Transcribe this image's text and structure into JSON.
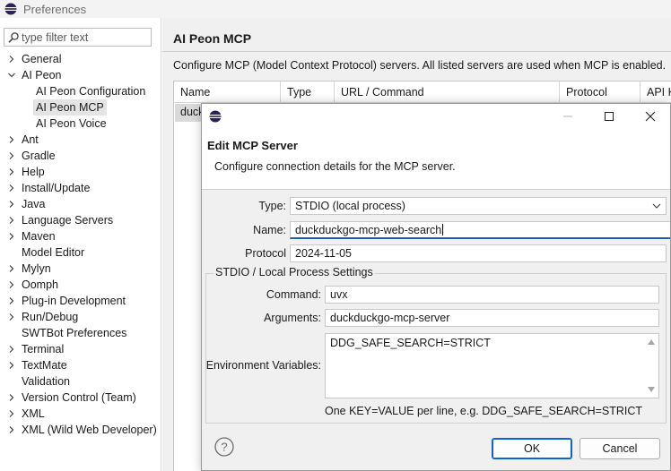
{
  "window": {
    "title": "Preferences"
  },
  "filter": {
    "placeholder": "type filter text"
  },
  "tree": [
    {
      "label": "General",
      "toggle": "collapsed",
      "level": 0
    },
    {
      "label": "AI Peon",
      "toggle": "expanded",
      "level": 0
    },
    {
      "label": "AI Peon Configuration",
      "toggle": "none",
      "level": 1
    },
    {
      "label": "AI Peon MCP",
      "toggle": "none",
      "level": 1,
      "selected": true
    },
    {
      "label": "AI Peon Voice",
      "toggle": "none",
      "level": 1
    },
    {
      "label": "Ant",
      "toggle": "collapsed",
      "level": 0
    },
    {
      "label": "Gradle",
      "toggle": "collapsed",
      "level": 0
    },
    {
      "label": "Help",
      "toggle": "collapsed",
      "level": 0
    },
    {
      "label": "Install/Update",
      "toggle": "collapsed",
      "level": 0
    },
    {
      "label": "Java",
      "toggle": "collapsed",
      "level": 0
    },
    {
      "label": "Language Servers",
      "toggle": "collapsed",
      "level": 0
    },
    {
      "label": "Maven",
      "toggle": "collapsed",
      "level": 0
    },
    {
      "label": "Model Editor",
      "toggle": "none",
      "level": 0
    },
    {
      "label": "Mylyn",
      "toggle": "collapsed",
      "level": 0
    },
    {
      "label": "Oomph",
      "toggle": "collapsed",
      "level": 0
    },
    {
      "label": "Plug-in Development",
      "toggle": "collapsed",
      "level": 0
    },
    {
      "label": "Run/Debug",
      "toggle": "collapsed",
      "level": 0
    },
    {
      "label": "SWTBot Preferences",
      "toggle": "none",
      "level": 0
    },
    {
      "label": "Terminal",
      "toggle": "collapsed",
      "level": 0
    },
    {
      "label": "TextMate",
      "toggle": "collapsed",
      "level": 0
    },
    {
      "label": "Validation",
      "toggle": "none",
      "level": 0
    },
    {
      "label": "Version Control (Team)",
      "toggle": "collapsed",
      "level": 0
    },
    {
      "label": "XML",
      "toggle": "collapsed",
      "level": 0
    },
    {
      "label": "XML (Wild Web Developer)",
      "toggle": "collapsed",
      "level": 0
    }
  ],
  "page": {
    "title": "AI Peon MCP",
    "description": "Configure MCP (Model Context Protocol) servers. All listed servers are used when MCP is enabled.",
    "columns": [
      "Name",
      "Type",
      "URL / Command",
      "Protocol",
      "API K"
    ],
    "rows": [
      {
        "name": "duck"
      }
    ]
  },
  "dialog": {
    "title": "Edit MCP Server",
    "description": "Configure connection details for the MCP server.",
    "type_label": "Type:",
    "type_value": "STDIO (local process)",
    "name_label": "Name:",
    "name_value": "duckduckgo-mcp-web-search",
    "protocol_label": "Protocol Version:",
    "protocol_value": "2024-11-05",
    "group_title": "STDIO / Local Process Settings",
    "command_label": "Command:",
    "command_value": "uvx",
    "arguments_label": "Arguments:",
    "arguments_value": "duckduckgo-mcp-server",
    "env_label": "Environment Variables:",
    "env_value": "DDG_SAFE_SEARCH=STRICT",
    "env_hint": "One KEY=VALUE per line, e.g.  DDG_SAFE_SEARCH=STRICT",
    "ok_label": "OK",
    "cancel_label": "Cancel"
  },
  "colors": {
    "focus_accent": "#1a5fb4",
    "default_button": "#0a64d6",
    "selection": "#e4e4e4"
  }
}
